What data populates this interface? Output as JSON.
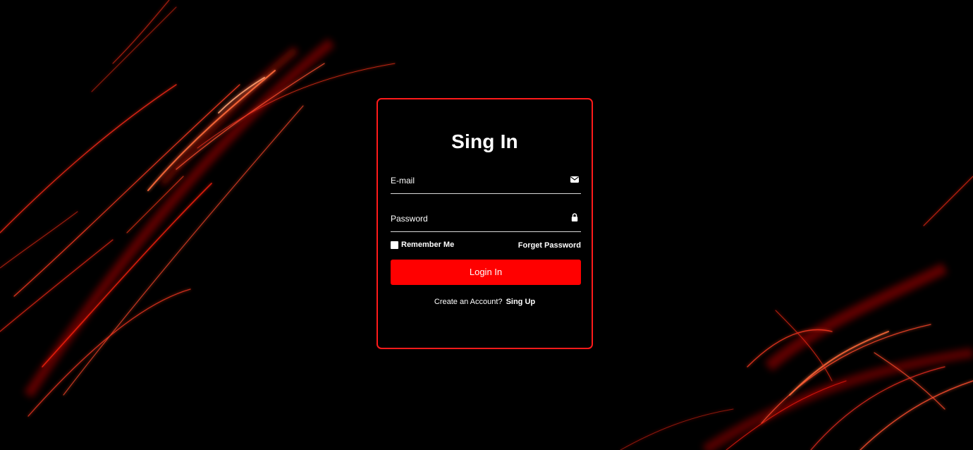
{
  "page": {
    "accent_color": "#ff0000",
    "border_color": "#ff1a1a",
    "background_color": "#000000"
  },
  "form": {
    "title": "Sing In",
    "email": {
      "placeholder": "E-mail",
      "value": "",
      "icon": "envelope-icon"
    },
    "password": {
      "placeholder": "Password",
      "value": "",
      "icon": "lock-icon"
    },
    "remember_label": "Remember Me",
    "remember_checked": false,
    "forget_label": "Forget Password",
    "login_label": "Login In",
    "create_account_text": "Create an Account?",
    "signup_label": "Sing Up"
  }
}
